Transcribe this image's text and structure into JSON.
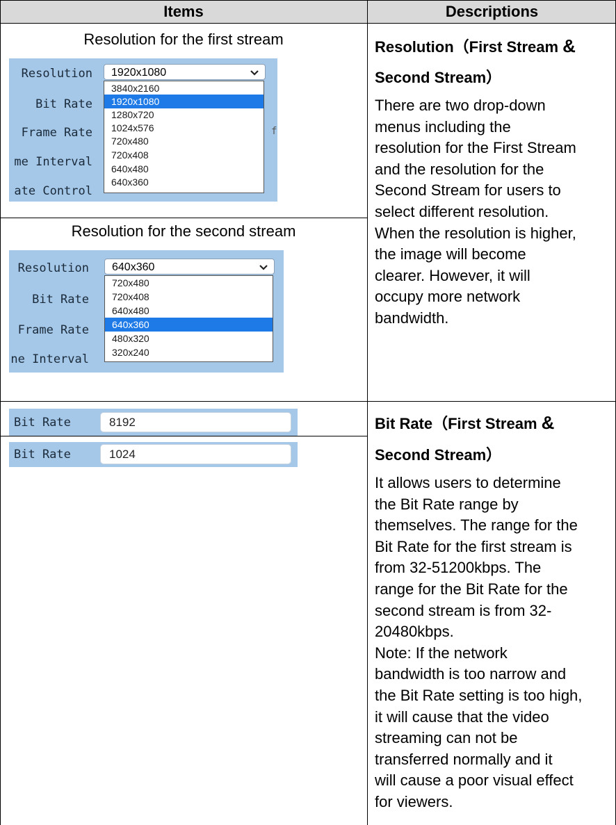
{
  "table": {
    "header_items": "Items",
    "header_descriptions": "Descriptions"
  },
  "resolution_row": {
    "caption_first": "Resolution for the first stream",
    "caption_second": "Resolution for the second stream",
    "first_panel": {
      "labels": [
        "Resolution",
        "Bit Rate",
        "Frame Rate",
        "me Interval",
        "ate Control"
      ],
      "selected_value": "1920x1080",
      "options": [
        "3840x2160",
        "1920x1080",
        "1280x720",
        "1024x576",
        "720x480",
        "720x408",
        "640x480",
        "640x360"
      ],
      "highlighted": "1920x1080",
      "edge_char": "f"
    },
    "second_panel": {
      "labels": [
        "Resolution",
        "Bit Rate",
        "Frame Rate",
        "ne Interval"
      ],
      "selected_value": "640x360",
      "options": [
        "720x480",
        "720x408",
        "640x480",
        "640x360",
        "480x320",
        "320x240"
      ],
      "highlighted": "640x360"
    },
    "desc_title_line1": "Resolution（First Stream",
    "desc_title_amp": "&",
    "desc_title_line2": "Second Stream）",
    "desc_body": "There are two drop-down\nmenus including the\nresolution for the First Stream\nand the resolution for the\nSecond Stream for users to\nselect different resolution.\nWhen the resolution is higher,\nthe image will become\nclearer. However, it will\noccupy more network\nbandwidth."
  },
  "bitrate_row": {
    "first": {
      "label": "Bit Rate",
      "value": "8192"
    },
    "second": {
      "label": "Bit Rate",
      "value": "1024"
    },
    "desc_title_line1": "Bit Rate（First Stream",
    "desc_title_amp": "&",
    "desc_title_line2": "Second Stream）",
    "desc_body": "It allows users to determine\nthe Bit Rate range by\nthemselves. The range for the\nBit Rate for the first stream is\nfrom 32-51200kbps. The\nrange for the Bit Rate for the\nsecond stream is from 32-\n20480kbps.\nNote: If the network\nbandwidth is too narrow and\nthe Bit Rate setting is too high,\nit will cause that the video\nstreaming can not be\ntransferred normally and it\nwill cause a poor visual effect\nfor viewers."
  },
  "colors": {
    "header_bg": "#d9d9d9",
    "panel_bg": "#a5c8e8",
    "highlight": "#1e7ae6",
    "border": "#000000"
  }
}
